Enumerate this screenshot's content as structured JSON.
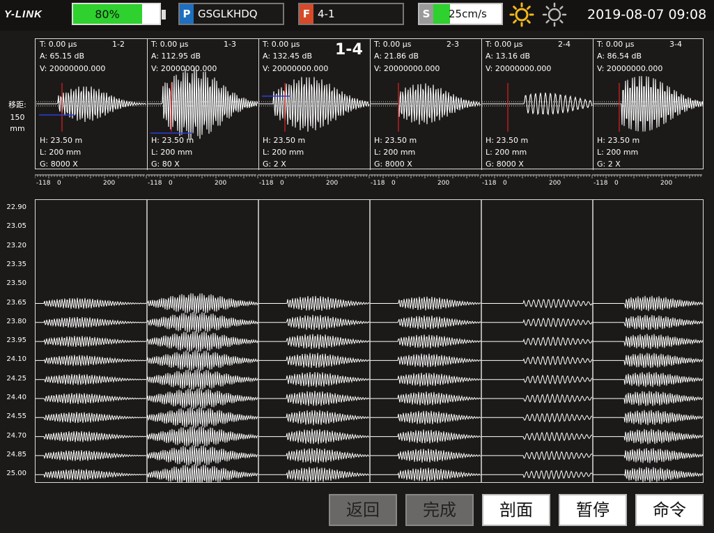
{
  "header": {
    "logo": "Y-LINK",
    "battery": {
      "label": "80%",
      "level": 0.8
    },
    "project": {
      "tag": "P",
      "value": "GSGLKHDQ",
      "tag_color": "#1e6fc0"
    },
    "file": {
      "tag": "F",
      "value": "4-1",
      "tag_color": "#d64a2a"
    },
    "speed": {
      "tag": "S",
      "value": "25cm/s",
      "level": 0.2
    },
    "brightness_up_icon": "sun-bright-icon",
    "brightness_down_icon": "sun-dim-icon",
    "datetime": "2019-08-07 09:08"
  },
  "side": {
    "label1": "移距:",
    "label2": "150",
    "label3": "mm"
  },
  "channels": [
    {
      "t_label": "T:  0.00  μs",
      "a_label": "A:  65.15 dB",
      "v_label": "V:  20000000.000",
      "id": "1-2",
      "h_label": "H:  23.50 m",
      "l_label": "L:  200 mm",
      "g_label": "G:  8000 X",
      "active": false
    },
    {
      "t_label": "T:  0.00  μs",
      "a_label": "A:  112.95 dB",
      "v_label": "V:  20000000.000",
      "id": "1-3",
      "h_label": "H:  23.50 m",
      "l_label": "L:  200 mm",
      "g_label": "G:  80 X",
      "active": false
    },
    {
      "t_label": "T:  0.00  μs",
      "a_label": "A:  132.45 dB",
      "v_label": "V:  20000000.000",
      "id": "1-4",
      "h_label": "H:  23.50 m",
      "l_label": "L:  200 mm",
      "g_label": "G:  2 X",
      "active": true
    },
    {
      "t_label": "T:  0.00  μs",
      "a_label": "A:  21.86 dB",
      "v_label": "V:  20000000.000",
      "id": "2-3",
      "h_label": "H:  23.50 m",
      "l_label": "L:  200 mm",
      "g_label": "G:  8000 X",
      "active": false
    },
    {
      "t_label": "T:  0.00  μs",
      "a_label": "A:  13.16 dB",
      "v_label": "V:  20000000.000",
      "id": "2-4",
      "h_label": "H:  23.50 m",
      "l_label": "L:  200 mm",
      "g_label": "G:  8000 X",
      "active": false
    },
    {
      "t_label": "T:  0.00  μs",
      "a_label": "A:  86.54 dB",
      "v_label": "V:  20000000.000",
      "id": "3-4",
      "h_label": "H:  23.50 m",
      "l_label": "L:  200 mm",
      "g_label": "G:  2 X",
      "active": false
    }
  ],
  "axis_ticks": [
    "-118",
    "0",
    "200"
  ],
  "depth_labels": [
    "22.90",
    "23.05",
    "23.20",
    "23.35",
    "23.50",
    "23.65",
    "23.80",
    "23.95",
    "24.10",
    "24.25",
    "24.40",
    "24.55",
    "24.70",
    "24.85",
    "25.00"
  ],
  "buttons": {
    "back": "返回",
    "finish": "完成",
    "profile": "剖面",
    "pause": "暂停",
    "command": "命令"
  }
}
